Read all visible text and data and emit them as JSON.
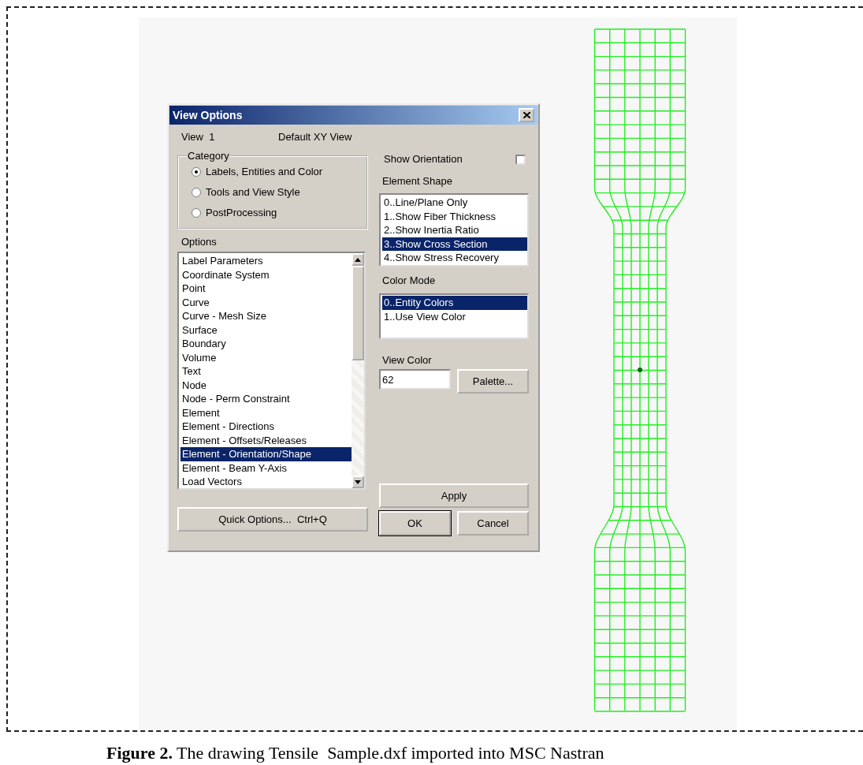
{
  "dialog": {
    "title": "View Options",
    "view_number": "View  1",
    "view_name": "Default XY View",
    "category": {
      "label": "Category",
      "options": [
        {
          "label": "Labels, Entities and Color",
          "selected": true
        },
        {
          "label": "Tools and View Style",
          "selected": false
        },
        {
          "label": "PostProcessing",
          "selected": false
        }
      ]
    },
    "options": {
      "label": "Options",
      "items": [
        {
          "label": "Label Parameters",
          "selected": false
        },
        {
          "label": "Coordinate System",
          "selected": false
        },
        {
          "label": "Point",
          "selected": false
        },
        {
          "label": "Curve",
          "selected": false
        },
        {
          "label": "Curve - Mesh Size",
          "selected": false
        },
        {
          "label": "Surface",
          "selected": false
        },
        {
          "label": "Boundary",
          "selected": false
        },
        {
          "label": "Volume",
          "selected": false
        },
        {
          "label": "Text",
          "selected": false
        },
        {
          "label": "Node",
          "selected": false
        },
        {
          "label": "Node - Perm Constraint",
          "selected": false
        },
        {
          "label": "Element",
          "selected": false
        },
        {
          "label": "Element - Directions",
          "selected": false
        },
        {
          "label": "Element - Offsets/Releases",
          "selected": false
        },
        {
          "label": "Element - Orientation/Shape",
          "selected": true
        },
        {
          "label": "Element - Beam Y-Axis",
          "selected": false
        },
        {
          "label": "Load Vectors",
          "selected": false
        }
      ]
    },
    "show_orientation": {
      "label": "Show Orientation",
      "checked": false
    },
    "element_shape": {
      "label": "Element Shape",
      "items": [
        {
          "label": "0..Line/Plane Only",
          "selected": false
        },
        {
          "label": "1..Show Fiber Thickness",
          "selected": false
        },
        {
          "label": "2..Show Inertia Ratio",
          "selected": false
        },
        {
          "label": "3..Show Cross Section",
          "selected": true
        },
        {
          "label": "4..Show Stress Recovery",
          "selected": false
        }
      ]
    },
    "color_mode": {
      "label": "Color Mode",
      "items": [
        {
          "label": "0..Entity Colors",
          "selected": true
        },
        {
          "label": "1..Use View Color",
          "selected": false
        }
      ]
    },
    "view_color": {
      "label": "View Color",
      "value": "62",
      "button": "Palette..."
    },
    "quick_options": "Quick Options...  Ctrl+Q",
    "apply": "Apply",
    "ok": "OK",
    "cancel": "Cancel"
  },
  "caption": "**Figure 2.** The drawing Tensile  Sample.dxf imported into MSC Nastran"
}
